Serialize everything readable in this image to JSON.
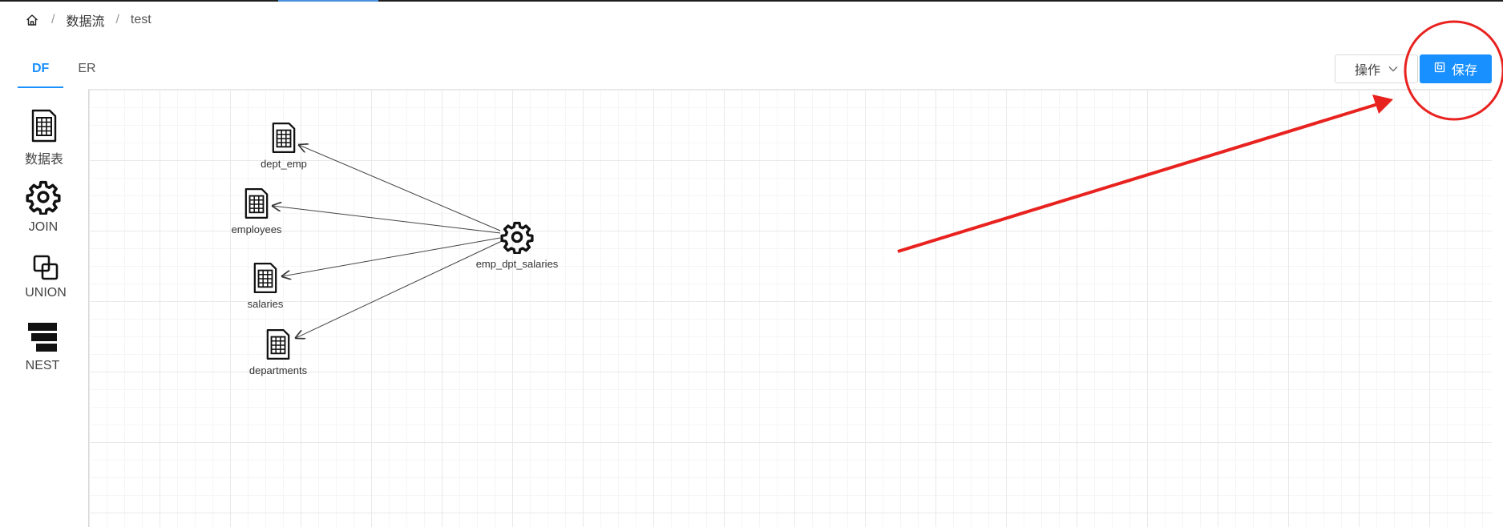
{
  "breadcrumb": {
    "home_icon": "home-icon",
    "items": [
      "数据流",
      "test"
    ]
  },
  "tabs": [
    {
      "label": "DF",
      "active": true
    },
    {
      "label": "ER",
      "active": false
    }
  ],
  "toolbar": {
    "operations_label": "操作",
    "save_label": "保存"
  },
  "palette": [
    {
      "label": "数据表",
      "icon": "table-file-icon"
    },
    {
      "label": "JOIN",
      "icon": "gear-icon"
    },
    {
      "label": "UNION",
      "icon": "union-squares-icon"
    },
    {
      "label": "NEST",
      "icon": "nest-bars-icon"
    }
  ],
  "graph": {
    "nodes": [
      {
        "label": "dept_emp",
        "type": "table"
      },
      {
        "label": "employees",
        "type": "table"
      },
      {
        "label": "salaries",
        "type": "table"
      },
      {
        "label": "departments",
        "type": "table"
      },
      {
        "label": "emp_dpt_salaries",
        "type": "join"
      }
    ]
  },
  "annotation": {
    "color": "#e8221f",
    "shapes": [
      "circle",
      "arrow"
    ]
  },
  "colors": {
    "primary": "#1890ff"
  }
}
